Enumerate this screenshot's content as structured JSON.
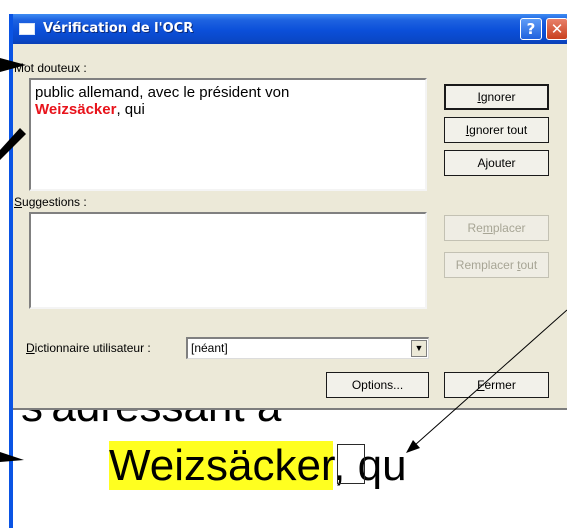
{
  "window": {
    "title": "Vérification de l'OCR",
    "help_button": "?",
    "close_button": "✕"
  },
  "doubtful": {
    "label": "Mot douteux :",
    "text_before": "public allemand, avec le président von",
    "word": "Weizsäcker",
    "text_after": ", qui"
  },
  "suggestions": {
    "label_key": "S",
    "label_rest": "uggestions :"
  },
  "buttons": {
    "ignore_key": "I",
    "ignore_rest": "gnorer",
    "ignore_all_key": "I",
    "ignore_all_rest": "gnorer tout",
    "add_pre": "A",
    "add_key": "j",
    "add_rest": "outer",
    "replace_pre": "Re",
    "replace_key": "m",
    "replace_rest": "placer",
    "replace_all_pre": "Remplacer ",
    "replace_all_key": "t",
    "replace_all_rest": "out",
    "options": "Options...",
    "close_key": "F",
    "close_rest": "ermer"
  },
  "dictionary": {
    "label_key": "D",
    "label_rest": "ictionnaire utilisateur :",
    "value": "[néant]"
  },
  "preview": {
    "ghost_text": "s'adressant à",
    "word": "Weizsäcker",
    "after": ", qu"
  },
  "colors": {
    "title_bar": "#0a4fd9",
    "dialog_bg": "#ece9d8",
    "doubtful_word": "#e8131b",
    "highlight": "#ffff20"
  }
}
